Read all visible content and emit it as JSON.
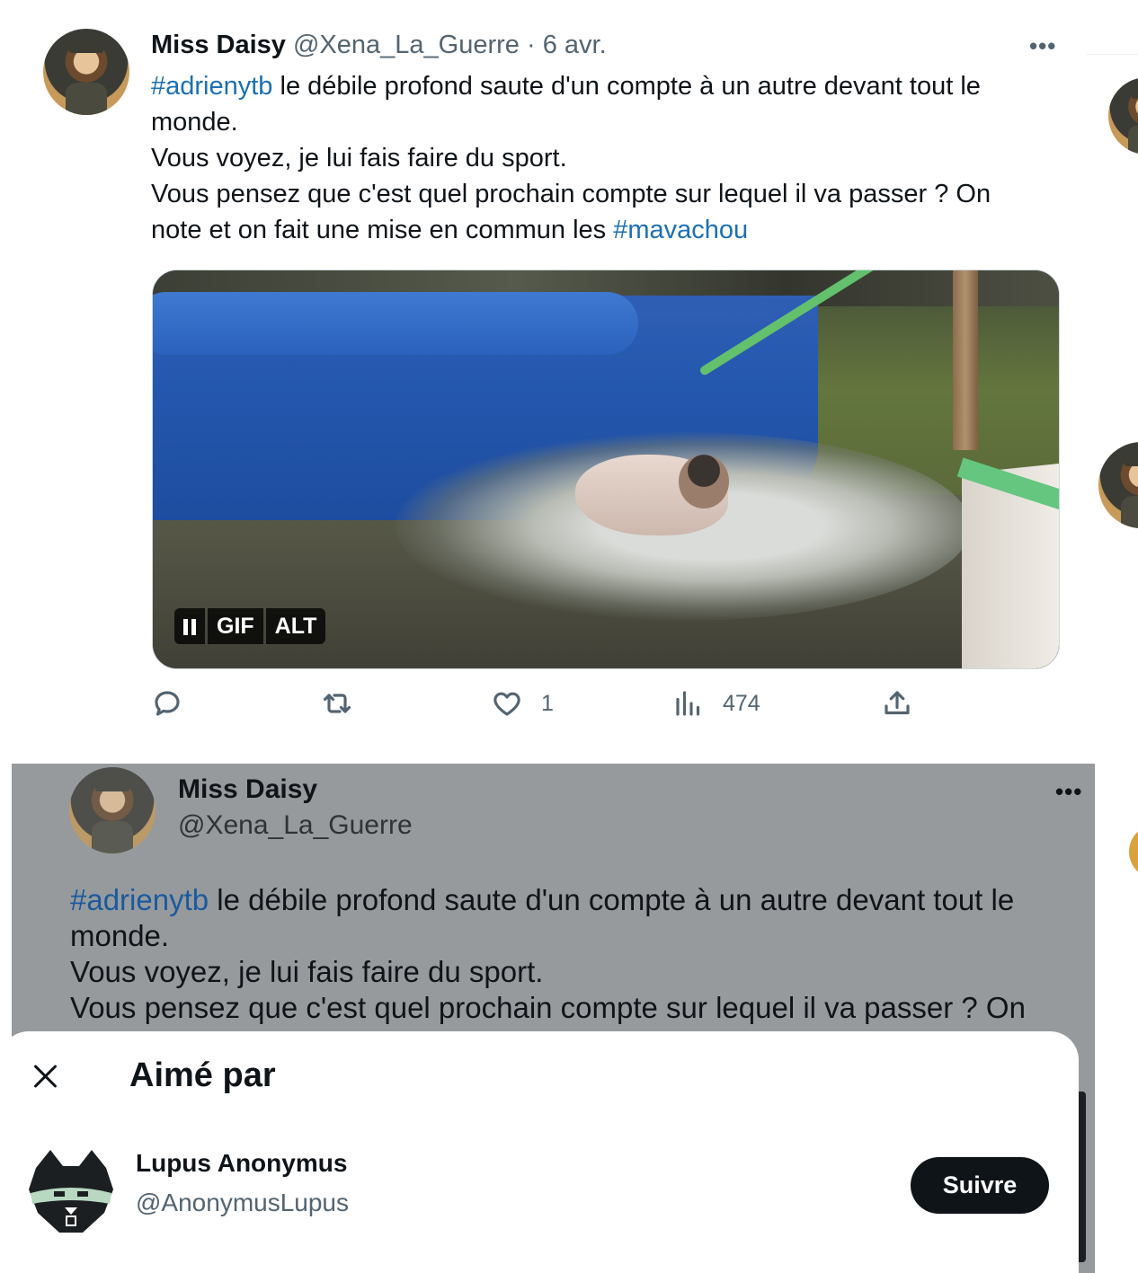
{
  "tweet": {
    "author_name": "Miss Daisy",
    "meta": "@Xena_La_Guerre · 6 avr.",
    "more": "•••",
    "text_lines": [
      {
        "tag": "#adrienytb",
        "rest": " le débile profond saute d'un compte à un autre devant tout le"
      },
      {
        "tag": "",
        "rest": "monde."
      },
      {
        "tag": "",
        "rest": "Vous voyez, je lui fais faire du sport."
      },
      {
        "tag": "",
        "rest": "Vous pensez que c'est quel prochain compte sur lequel il va passer ? On"
      },
      {
        "tag": "",
        "rest": "note et on fait une mise en commun les ",
        "tag_end": "#mavachou"
      }
    ],
    "media": {
      "badge_gif": "GIF",
      "badge_alt": "ALT"
    },
    "actions": {
      "reply_icon": "reply-icon",
      "retweet_icon": "retweet-icon",
      "like_icon": "heart-icon",
      "like_count": "1",
      "views_icon": "views-icon",
      "views_count": "474",
      "share_icon": "share-icon"
    }
  },
  "quoted": {
    "author_name": "Miss Daisy",
    "handle": "@Xena_La_Guerre",
    "more": "•••",
    "text_lines": [
      {
        "tag": "#adrienytb",
        "rest": " le débile profond saute d'un compte à un autre devant tout le"
      },
      {
        "tag": "",
        "rest": "monde."
      },
      {
        "tag": "",
        "rest": "Vous voyez, je lui fais faire du sport."
      },
      {
        "tag": "",
        "rest": "Vous pensez que c'est quel prochain compte sur lequel il va passer ? On"
      }
    ]
  },
  "sheet": {
    "title": "Aimé par",
    "users": [
      {
        "name": "Lupus Anonymus",
        "handle": "@AnonymusLupus",
        "follow_label": "Suivre"
      }
    ]
  },
  "colors": {
    "hashtag": "#1d6fb4",
    "overlay": "#979a9d",
    "follow_button": "#0f1419"
  }
}
